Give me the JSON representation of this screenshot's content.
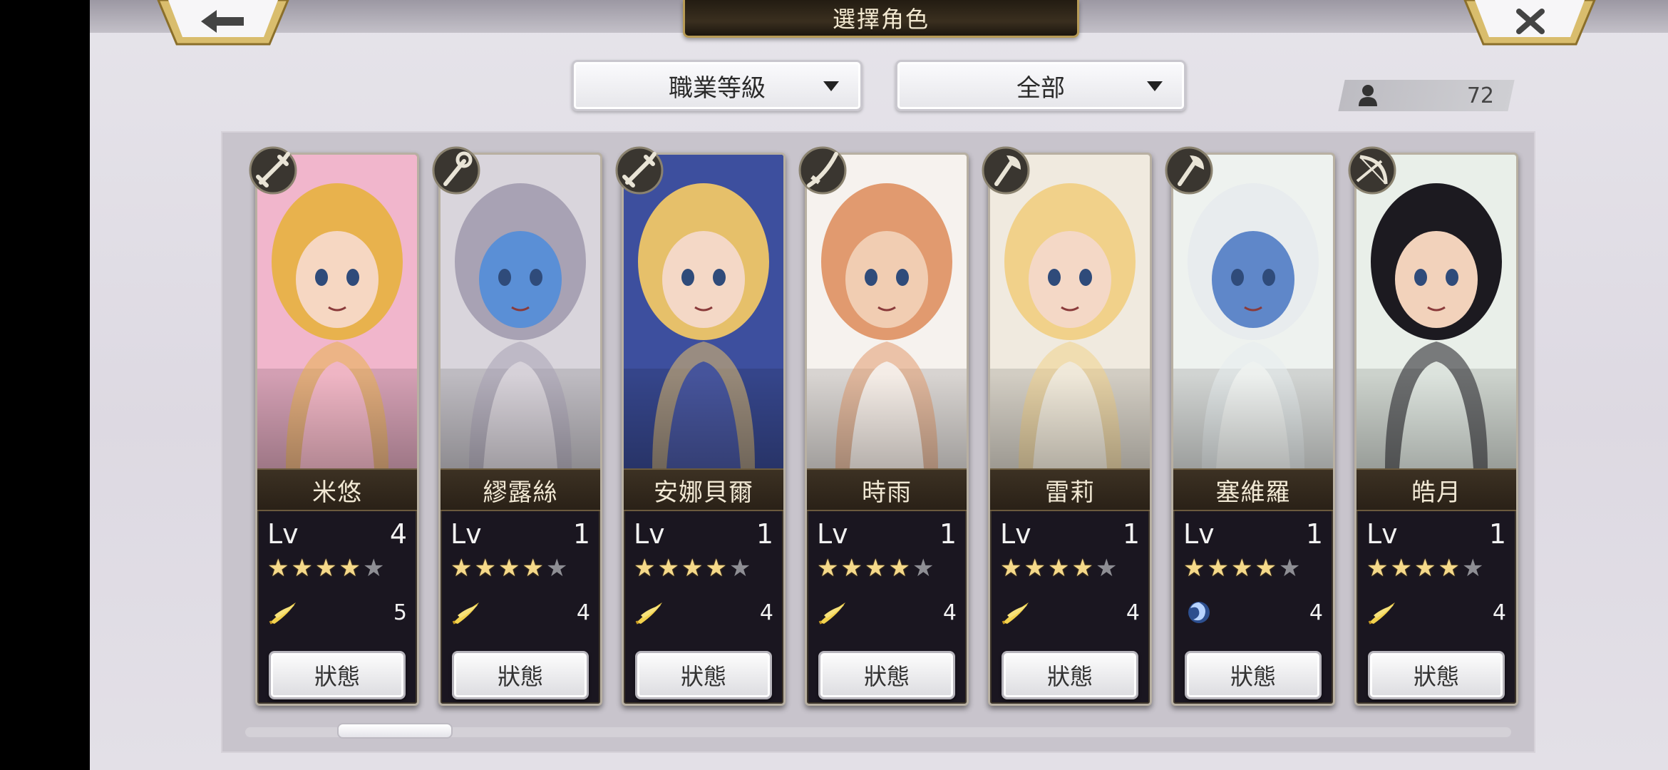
{
  "header": {
    "title": "選擇角色"
  },
  "filters": {
    "job_level": "職業等級",
    "category": "全部"
  },
  "roster_count": "72",
  "icons": {
    "back": "back-arrow-icon",
    "close": "close-x-icon",
    "user": "person-icon",
    "dropdown": "caret-down-icon"
  },
  "characters": [
    {
      "name": "米悠",
      "lv_label": "Lv",
      "level": "4",
      "stars": 4,
      "max_stars": 5,
      "element": "wind",
      "element_count": "5",
      "button": "狀態",
      "weapon": "sword-icon",
      "theme": "#f1b6cc",
      "hair": "#e8b24d",
      "skin": "#f6d7c2"
    },
    {
      "name": "繆露絲",
      "lv_label": "Lv",
      "level": "1",
      "stars": 4,
      "max_stars": 5,
      "element": "wind",
      "element_count": "4",
      "button": "狀態",
      "weapon": "staff-icon",
      "theme": "#d9d5dc",
      "hair": "#a8a2b4",
      "skin": "#5a8fd6"
    },
    {
      "name": "安娜貝爾",
      "lv_label": "Lv",
      "level": "1",
      "stars": 4,
      "max_stars": 5,
      "element": "wind",
      "element_count": "4",
      "button": "狀態",
      "weapon": "sword-icon",
      "theme": "#3d4f9e",
      "hair": "#e6c06a",
      "skin": "#f4d8c6"
    },
    {
      "name": "時雨",
      "lv_label": "Lv",
      "level": "1",
      "stars": 4,
      "max_stars": 5,
      "element": "wind",
      "element_count": "4",
      "button": "狀態",
      "weapon": "katana-icon",
      "theme": "#f6f2ee",
      "hair": "#e19a6f",
      "skin": "#f1cdb2"
    },
    {
      "name": "雷莉",
      "lv_label": "Lv",
      "level": "1",
      "stars": 4,
      "max_stars": 5,
      "element": "wind",
      "element_count": "4",
      "button": "狀態",
      "weapon": "axe-icon",
      "theme": "#f0eadf",
      "hair": "#f1d18a",
      "skin": "#f4d8c6"
    },
    {
      "name": "塞維羅",
      "lv_label": "Lv",
      "level": "1",
      "stars": 4,
      "max_stars": 5,
      "element": "water",
      "element_count": "4",
      "button": "狀態",
      "weapon": "axe-icon",
      "theme": "#eef2ef",
      "hair": "#e8ecee",
      "skin": "#5f87c9"
    },
    {
      "name": "皓月",
      "lv_label": "Lv",
      "level": "1",
      "stars": 4,
      "max_stars": 5,
      "element": "wind",
      "element_count": "4",
      "button": "狀態",
      "weapon": "bow-icon",
      "theme": "#e9efe9",
      "hair": "#1c1a20",
      "skin": "#f2d2bb"
    }
  ],
  "scroll_position": 0.08
}
